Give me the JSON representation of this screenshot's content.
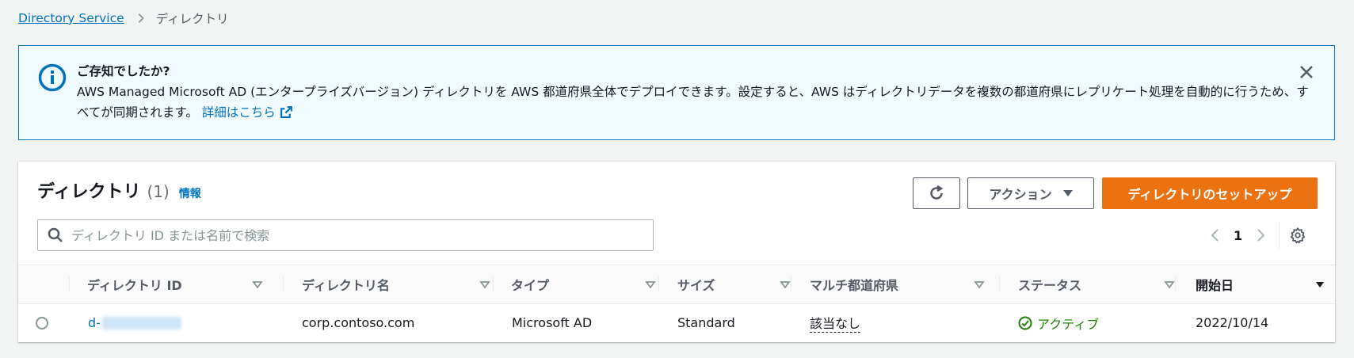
{
  "breadcrumb": {
    "root": "Directory Service",
    "current": "ディレクトリ"
  },
  "alert": {
    "title": "ご存知でしたか?",
    "body": "AWS Managed Microsoft AD (エンタープライズバージョン) ディレクトリを AWS 都道府県全体でデプロイできます。設定すると、AWS はディレクトリデータを複数の都道府県にレプリケート処理を自動的に行うため、すべてが同期されます。",
    "link": "詳細はこちら"
  },
  "table_panel": {
    "title": "ディレクトリ",
    "count": "(1)",
    "info": "情報",
    "actions_label": "アクション",
    "setup_label": "ディレクトリのセットアップ",
    "search_placeholder": "ディレクトリ ID または名前で検索",
    "page": "1",
    "columns": [
      "ディレクトリ ID",
      "ディレクトリ名",
      "タイプ",
      "サイズ",
      "マルチ都道府県",
      "ステータス",
      "開始日"
    ],
    "rows": [
      {
        "id_prefix": "d-",
        "name": "corp.contoso.com",
        "type": "Microsoft AD",
        "size": "Standard",
        "multi_region": "該当なし",
        "status": "アクティブ",
        "started": "2022/10/14"
      }
    ]
  },
  "colors": {
    "accent": "#0073bb",
    "primary_button": "#ec7211",
    "success": "#1d8102",
    "alert_background": "#f1faff"
  }
}
